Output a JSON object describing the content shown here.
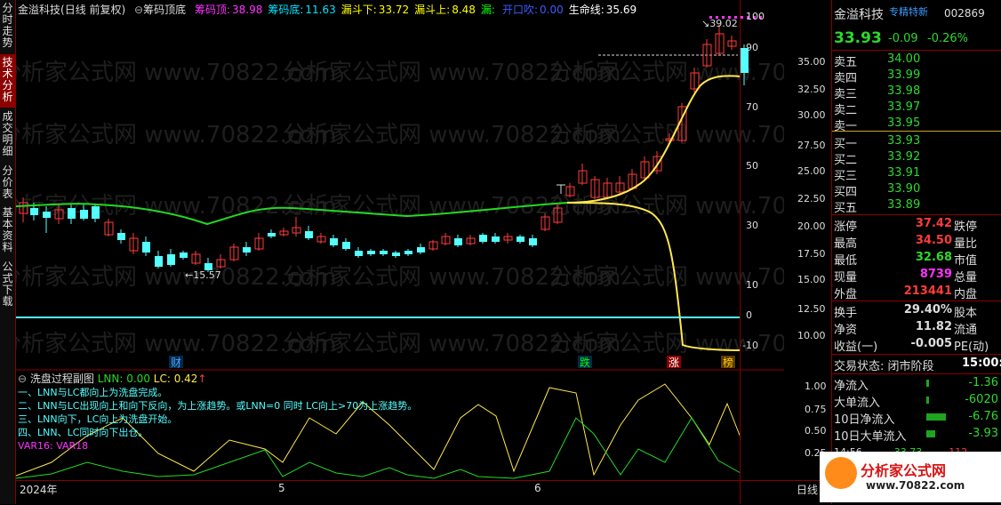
{
  "left_tabs": [
    {
      "label": "分时走势",
      "active": false
    },
    {
      "label": "技术分析",
      "active": true
    },
    {
      "label": "成交明细",
      "active": false
    },
    {
      "label": "分价表",
      "active": false
    },
    {
      "label": "基本资料",
      "active": false
    },
    {
      "label": "公式下载",
      "active": false
    }
  ],
  "header": {
    "stock": "金溢科技",
    "period": "(日线 前复权)",
    "formula": "筹码顶底",
    "items": [
      {
        "k": "筹码顶:",
        "v": "38.98",
        "color": "#ff33ff"
      },
      {
        "k": "筹码底:",
        "v": "11.63",
        "color": "#00e5ff"
      },
      {
        "k": "漏斗下:",
        "v": "33.72",
        "color": "#ffff00"
      },
      {
        "k": "漏斗上:",
        "v": "8.48",
        "color": "#ffff00"
      },
      {
        "k": "漏:",
        "v": "",
        "color": "#00ff00"
      },
      {
        "k": "开口吹:",
        "v": "0.00",
        "color": "#3b5bff"
      },
      {
        "k": "生命线:",
        "v": "35.69",
        "color": "#ffffff"
      }
    ]
  },
  "price_axis": [
    "35.00",
    "32.50",
    "30.00",
    "27.50",
    "25.00",
    "22.50",
    "20.00",
    "17.50",
    "15.00",
    "12.50",
    "10.00"
  ],
  "osc_axis": [
    "100",
    "90",
    "70",
    "50",
    "30",
    "10",
    "0",
    "-10"
  ],
  "annotations": {
    "high": "39.02",
    "low": "15.57"
  },
  "markers": [
    {
      "text": "财",
      "color": "#4aa3ff"
    },
    {
      "text": "跌",
      "color": "#00ff00"
    },
    {
      "text": "涨",
      "color": "#ffffff"
    },
    {
      "text": "榜",
      "color": "#ffcc00"
    }
  ],
  "sub": {
    "title": "洗盘过程副图",
    "lnn": "LNN: 0.00",
    "lc": "LC: 0.42",
    "arrow": "↑",
    "notes": [
      "一、LNN与LC都向上为洗盘完成。",
      "二、LNN与LC出现向上和向下反向，为上涨趋势。或LNN=0 同时 LC向上>70为上涨趋势。",
      "三、LNN向下，LC向上为洗盘开始。",
      "四、LNN、LC同时向下出仓。"
    ],
    "var": "VAR16: VAR18",
    "axis": [
      "1.00",
      "0.75",
      "0.50",
      "0.25"
    ]
  },
  "dates": [
    "2024年",
    "5",
    "6"
  ],
  "date_right": "日线",
  "right": {
    "name": "金溢科技",
    "tag": "专精特新",
    "code": "002869",
    "price": "33.93",
    "change": "-0.09",
    "pct": "-0.26%",
    "asks": [
      {
        "k": "卖五",
        "p": "34.00"
      },
      {
        "k": "卖四",
        "p": "33.99"
      },
      {
        "k": "卖三",
        "p": "33.98"
      },
      {
        "k": "卖二",
        "p": "33.97"
      },
      {
        "k": "卖一",
        "p": "33.95"
      }
    ],
    "bids": [
      {
        "k": "买一",
        "p": "33.93"
      },
      {
        "k": "买二",
        "p": "33.92"
      },
      {
        "k": "买三",
        "p": "33.91"
      },
      {
        "k": "买四",
        "p": "33.90"
      },
      {
        "k": "买五",
        "p": "33.89"
      }
    ],
    "stats": [
      {
        "k": "涨停",
        "v": "37.42",
        "vc": "#ff3b3b",
        "k2": "跌停"
      },
      {
        "k": "最高",
        "v": "34.50",
        "vc": "#ff3b3b",
        "k2": "量比"
      },
      {
        "k": "最低",
        "v": "32.68",
        "vc": "#2ed82e",
        "k2": "市值"
      },
      {
        "k": "现量",
        "v": "8739",
        "vc": "#ff33ff",
        "k2": "总量"
      },
      {
        "k": "外盘",
        "v": "213441",
        "vc": "#ff3b3b",
        "k2": "内盘"
      }
    ],
    "stats2": [
      {
        "k": "换手",
        "v": "29.40%",
        "k2": "股本"
      },
      {
        "k": "净资",
        "v": "11.82",
        "k2": "流通"
      },
      {
        "k": "收益(一)",
        "v": "-0.005",
        "k2": "PE(动)"
      }
    ],
    "status": "交易状态: 闭市阶段",
    "time": "15:00:",
    "flows": [
      {
        "k": "净流入",
        "v": "-1.36"
      },
      {
        "k": "大单流入",
        "v": "-6020"
      },
      {
        "k": "10日净流入",
        "v": "-6.76"
      },
      {
        "k": "10日大单流入",
        "v": "-3.93"
      }
    ],
    "tick": {
      "t": "14:56",
      "p": "33.73",
      "q": "112"
    },
    "logo": "分析家公式网",
    "logo_url": "www.70822.com"
  },
  "watermark": "分析家公式网 www.70822.com",
  "colors": {
    "up": "#ff3b3b",
    "down": "#54ffff",
    "green": "#23d923",
    "yellow": "#ffe84d"
  }
}
